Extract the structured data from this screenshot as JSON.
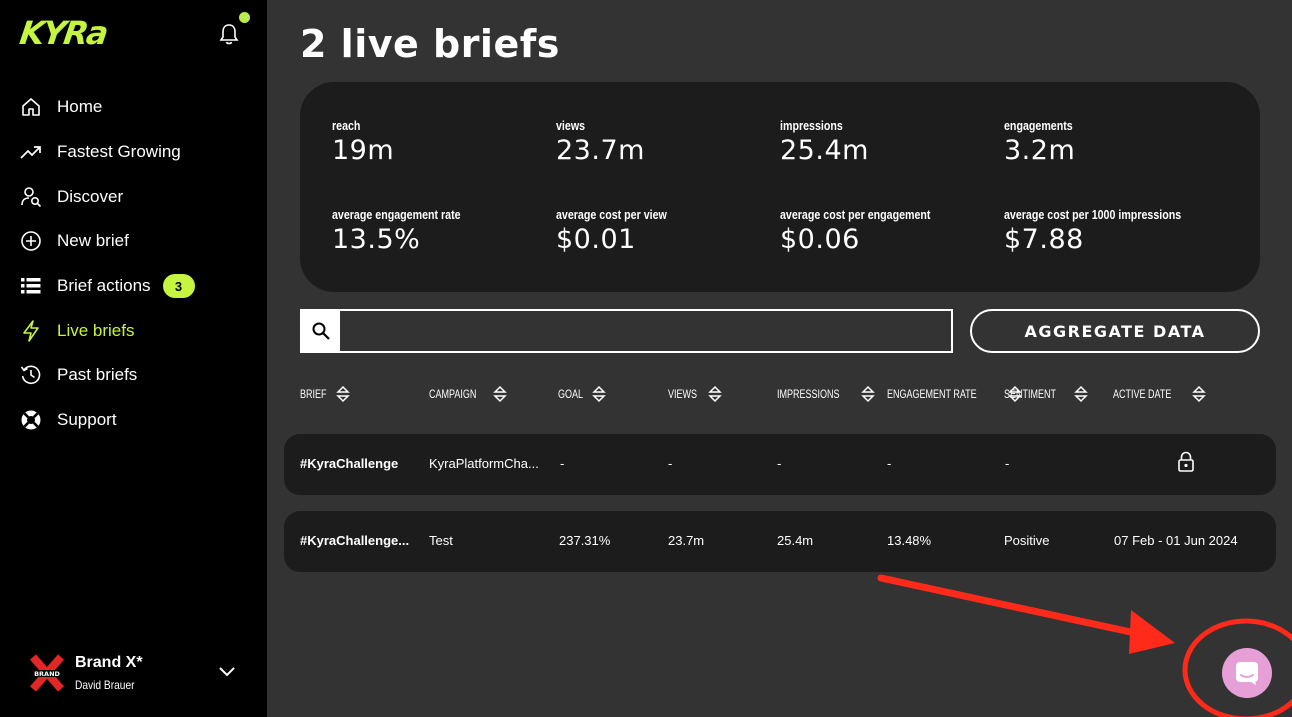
{
  "app": {
    "logo_text": "KYRa",
    "brand_color": "#c6f53f"
  },
  "sidebar": {
    "items": [
      {
        "label": "Home",
        "icon": "home-icon"
      },
      {
        "label": "Fastest Growing",
        "icon": "trending-up-icon"
      },
      {
        "label": "Discover",
        "icon": "discover-user-search-icon"
      },
      {
        "label": "New brief",
        "icon": "plus-circle-icon"
      },
      {
        "label": "Brief actions",
        "icon": "list-icon",
        "badge": "3"
      },
      {
        "label": "Live briefs",
        "icon": "lightning-icon",
        "active": true
      },
      {
        "label": "Past briefs",
        "icon": "history-icon"
      },
      {
        "label": "Support",
        "icon": "lifebuoy-icon"
      }
    ],
    "account": {
      "brand_name": "Brand X*",
      "user_name": "David Brauer",
      "brand_logo_text": "BRAND"
    }
  },
  "main": {
    "title": "2 live briefs",
    "stats": [
      {
        "label": "reach",
        "value": "19m"
      },
      {
        "label": "views",
        "value": "23.7m"
      },
      {
        "label": "impressions",
        "value": "25.4m"
      },
      {
        "label": "engagements",
        "value": "3.2m"
      },
      {
        "label": "average engagement rate",
        "value": "13.5%"
      },
      {
        "label": "average cost per view",
        "value": "$0.01"
      },
      {
        "label": "average cost per engagement",
        "value": "$0.06"
      },
      {
        "label": "average cost per 1000 impressions",
        "value": "$7.88"
      }
    ],
    "search": {
      "value": "",
      "placeholder": ""
    },
    "aggregate_button": "AGGREGATE DATA",
    "table": {
      "columns": [
        "BRIEF",
        "CAMPAIGN",
        "GOAL",
        "VIEWS",
        "IMPRESSIONS",
        "ENGAGEMENT RATE",
        "SENTIMENT",
        "ACTIVE DATE"
      ],
      "rows": [
        {
          "brief": "#KyraChallenge",
          "campaign": "KyraPlatformCha...",
          "goal": "-",
          "views": "-",
          "impressions": "-",
          "engagement_rate": "-",
          "sentiment": "-",
          "active_date": "",
          "locked": true
        },
        {
          "brief": "#KyraChallenge...",
          "campaign": "Test",
          "goal": "237.31%",
          "views": "23.7m",
          "impressions": "25.4m",
          "engagement_rate": "13.48%",
          "sentiment": "Positive",
          "active_date": "07 Feb - 01 Jun 2024",
          "locked": false
        }
      ]
    }
  },
  "annotation": {
    "color": "#ff2a1a"
  },
  "chat_widget": {
    "icon": "chat-icon",
    "color": "#e7a0d7"
  }
}
